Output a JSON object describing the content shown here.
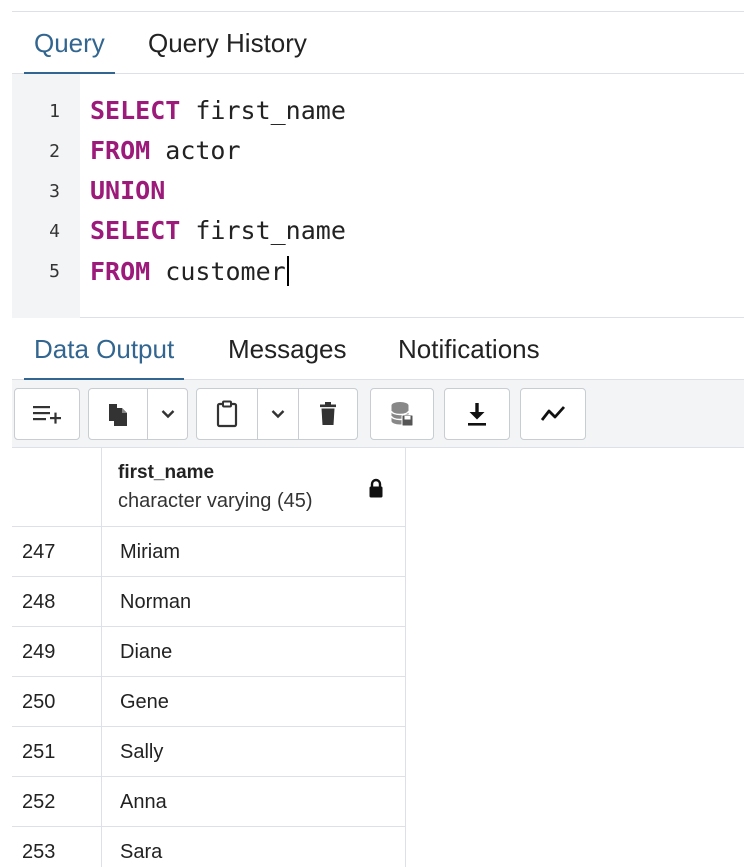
{
  "query_tabs": [
    {
      "label": "Query",
      "active": true
    },
    {
      "label": "Query History",
      "active": false
    }
  ],
  "editor": {
    "lines": [
      {
        "num": "1",
        "keyword": "SELECT",
        "rest": " first_name"
      },
      {
        "num": "2",
        "keyword": "FROM",
        "rest": " actor"
      },
      {
        "num": "3",
        "keyword": "UNION",
        "rest": ""
      },
      {
        "num": "4",
        "keyword": "SELECT",
        "rest": " first_name"
      },
      {
        "num": "5",
        "keyword": "FROM",
        "rest": " customer"
      }
    ]
  },
  "output_tabs": [
    {
      "label": "Data Output",
      "active": true
    },
    {
      "label": "Messages",
      "active": false
    },
    {
      "label": "Notifications",
      "active": false
    }
  ],
  "toolbar": {
    "icons": [
      "add-row-icon",
      "copy-icon",
      "dropdown-icon",
      "paste-icon",
      "dropdown-icon",
      "delete-icon",
      "save-data-icon",
      "download-icon",
      "graph-icon"
    ]
  },
  "grid": {
    "column": {
      "name": "first_name",
      "type": "character varying (45)",
      "icon": "lock-icon"
    },
    "rows": [
      {
        "num": "247",
        "value": "Miriam"
      },
      {
        "num": "248",
        "value": "Norman"
      },
      {
        "num": "249",
        "value": "Diane"
      },
      {
        "num": "250",
        "value": "Gene"
      },
      {
        "num": "251",
        "value": "Sally"
      },
      {
        "num": "252",
        "value": "Anna"
      },
      {
        "num": "253",
        "value": "Sara"
      }
    ]
  },
  "colors": {
    "accent": "#326690",
    "keyword": "#9c1a7a",
    "border": "#dde0e6"
  }
}
